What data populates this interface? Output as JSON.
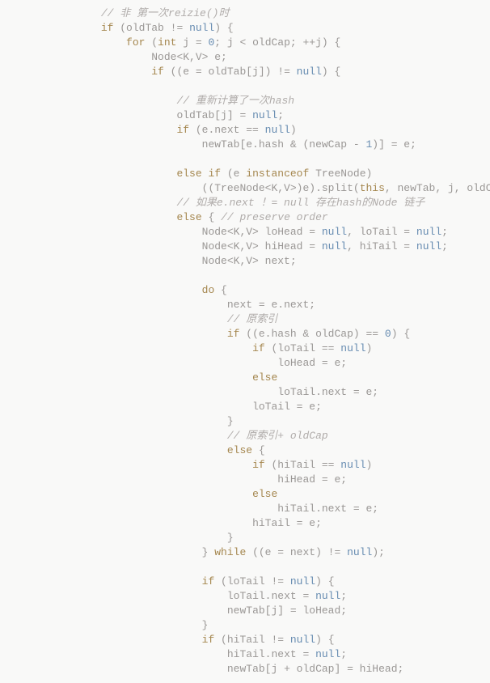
{
  "code": {
    "lines": [
      {
        "indent": 2,
        "tokens": [
          {
            "t": "cm",
            "v": "// 非 第一次reizie()时"
          }
        ]
      },
      {
        "indent": 2,
        "tokens": [
          {
            "t": "kw",
            "v": "if"
          },
          {
            "t": "pn",
            "v": " (oldTab != "
          },
          {
            "t": "kwn",
            "v": "null"
          },
          {
            "t": "pn",
            "v": ") {"
          }
        ]
      },
      {
        "indent": 3,
        "tokens": [
          {
            "t": "kw",
            "v": "for"
          },
          {
            "t": "pn",
            "v": " ("
          },
          {
            "t": "kw",
            "v": "int"
          },
          {
            "t": "pn",
            "v": " j = "
          },
          {
            "t": "num",
            "v": "0"
          },
          {
            "t": "pn",
            "v": "; j < oldCap; ++j) {"
          }
        ]
      },
      {
        "indent": 4,
        "tokens": [
          {
            "t": "id",
            "v": "Node<K,V> e;"
          }
        ]
      },
      {
        "indent": 4,
        "tokens": [
          {
            "t": "kw",
            "v": "if"
          },
          {
            "t": "pn",
            "v": " ((e = oldTab[j]) != "
          },
          {
            "t": "kwn",
            "v": "null"
          },
          {
            "t": "pn",
            "v": ") {"
          }
        ]
      },
      {
        "indent": 0,
        "tokens": [
          {
            "t": "pn",
            "v": " "
          }
        ]
      },
      {
        "indent": 5,
        "tokens": [
          {
            "t": "cm",
            "v": "// 重新计算了一次hash"
          }
        ]
      },
      {
        "indent": 5,
        "tokens": [
          {
            "t": "id",
            "v": "oldTab[j] = "
          },
          {
            "t": "kwn",
            "v": "null"
          },
          {
            "t": "pn",
            "v": ";"
          }
        ]
      },
      {
        "indent": 5,
        "tokens": [
          {
            "t": "kw",
            "v": "if"
          },
          {
            "t": "pn",
            "v": " (e.next == "
          },
          {
            "t": "kwn",
            "v": "null"
          },
          {
            "t": "pn",
            "v": ")"
          }
        ]
      },
      {
        "indent": 6,
        "tokens": [
          {
            "t": "id",
            "v": "newTab[e.hash & (newCap - "
          },
          {
            "t": "num",
            "v": "1"
          },
          {
            "t": "id",
            "v": ")] = e;"
          }
        ]
      },
      {
        "indent": 0,
        "tokens": [
          {
            "t": "pn",
            "v": " "
          }
        ]
      },
      {
        "indent": 5,
        "tokens": [
          {
            "t": "kw",
            "v": "else if"
          },
          {
            "t": "pn",
            "v": " (e "
          },
          {
            "t": "kw",
            "v": "instanceof"
          },
          {
            "t": "pn",
            "v": " TreeNode)"
          }
        ]
      },
      {
        "indent": 6,
        "tokens": [
          {
            "t": "id",
            "v": "((TreeNode<K,V>)e).split("
          },
          {
            "t": "kw",
            "v": "this"
          },
          {
            "t": "id",
            "v": ", newTab, j, oldCap);"
          }
        ]
      },
      {
        "indent": 5,
        "tokens": [
          {
            "t": "cm",
            "v": "// 如果e.next ！= null 存在hash的Node 链子"
          }
        ]
      },
      {
        "indent": 5,
        "tokens": [
          {
            "t": "kw",
            "v": "else"
          },
          {
            "t": "pn",
            "v": " { "
          },
          {
            "t": "cm",
            "v": "// preserve order"
          }
        ]
      },
      {
        "indent": 6,
        "tokens": [
          {
            "t": "id",
            "v": "Node<K,V> loHead = "
          },
          {
            "t": "kwn",
            "v": "null"
          },
          {
            "t": "id",
            "v": ", loTail = "
          },
          {
            "t": "kwn",
            "v": "null"
          },
          {
            "t": "pn",
            "v": ";"
          }
        ]
      },
      {
        "indent": 6,
        "tokens": [
          {
            "t": "id",
            "v": "Node<K,V> hiHead = "
          },
          {
            "t": "kwn",
            "v": "null"
          },
          {
            "t": "id",
            "v": ", hiTail = "
          },
          {
            "t": "kwn",
            "v": "null"
          },
          {
            "t": "pn",
            "v": ";"
          }
        ]
      },
      {
        "indent": 6,
        "tokens": [
          {
            "t": "id",
            "v": "Node<K,V> next;"
          }
        ]
      },
      {
        "indent": 0,
        "tokens": [
          {
            "t": "pn",
            "v": " "
          }
        ]
      },
      {
        "indent": 6,
        "tokens": [
          {
            "t": "kw",
            "v": "do"
          },
          {
            "t": "pn",
            "v": " {"
          }
        ]
      },
      {
        "indent": 7,
        "tokens": [
          {
            "t": "id",
            "v": "next = e.next;"
          }
        ]
      },
      {
        "indent": 7,
        "tokens": [
          {
            "t": "cm",
            "v": "// 原索引"
          }
        ]
      },
      {
        "indent": 7,
        "tokens": [
          {
            "t": "kw",
            "v": "if"
          },
          {
            "t": "pn",
            "v": " ((e.hash & oldCap) == "
          },
          {
            "t": "num",
            "v": "0"
          },
          {
            "t": "pn",
            "v": ") {"
          }
        ]
      },
      {
        "indent": 8,
        "tokens": [
          {
            "t": "kw",
            "v": "if"
          },
          {
            "t": "pn",
            "v": " (loTail == "
          },
          {
            "t": "kwn",
            "v": "null"
          },
          {
            "t": "pn",
            "v": ")"
          }
        ]
      },
      {
        "indent": 9,
        "tokens": [
          {
            "t": "id",
            "v": "loHead = e;"
          }
        ]
      },
      {
        "indent": 8,
        "tokens": [
          {
            "t": "kw",
            "v": "else"
          }
        ]
      },
      {
        "indent": 9,
        "tokens": [
          {
            "t": "id",
            "v": "loTail.next = e;"
          }
        ]
      },
      {
        "indent": 8,
        "tokens": [
          {
            "t": "id",
            "v": "loTail = e;"
          }
        ]
      },
      {
        "indent": 7,
        "tokens": [
          {
            "t": "pn",
            "v": "}"
          }
        ]
      },
      {
        "indent": 7,
        "tokens": [
          {
            "t": "cm",
            "v": "// 原索引+ oldCap"
          }
        ]
      },
      {
        "indent": 7,
        "tokens": [
          {
            "t": "kw",
            "v": "else"
          },
          {
            "t": "pn",
            "v": " {"
          }
        ]
      },
      {
        "indent": 8,
        "tokens": [
          {
            "t": "kw",
            "v": "if"
          },
          {
            "t": "pn",
            "v": " (hiTail == "
          },
          {
            "t": "kwn",
            "v": "null"
          },
          {
            "t": "pn",
            "v": ")"
          }
        ]
      },
      {
        "indent": 9,
        "tokens": [
          {
            "t": "id",
            "v": "hiHead = e;"
          }
        ]
      },
      {
        "indent": 8,
        "tokens": [
          {
            "t": "kw",
            "v": "else"
          }
        ]
      },
      {
        "indent": 9,
        "tokens": [
          {
            "t": "id",
            "v": "hiTail.next = e;"
          }
        ]
      },
      {
        "indent": 8,
        "tokens": [
          {
            "t": "id",
            "v": "hiTail = e;"
          }
        ]
      },
      {
        "indent": 7,
        "tokens": [
          {
            "t": "pn",
            "v": "}"
          }
        ]
      },
      {
        "indent": 6,
        "tokens": [
          {
            "t": "pn",
            "v": "} "
          },
          {
            "t": "kw",
            "v": "while"
          },
          {
            "t": "pn",
            "v": " ((e = next) != "
          },
          {
            "t": "kwn",
            "v": "null"
          },
          {
            "t": "pn",
            "v": ");"
          }
        ]
      },
      {
        "indent": 0,
        "tokens": [
          {
            "t": "pn",
            "v": " "
          }
        ]
      },
      {
        "indent": 6,
        "tokens": [
          {
            "t": "kw",
            "v": "if"
          },
          {
            "t": "pn",
            "v": " (loTail != "
          },
          {
            "t": "kwn",
            "v": "null"
          },
          {
            "t": "pn",
            "v": ") {"
          }
        ]
      },
      {
        "indent": 7,
        "tokens": [
          {
            "t": "id",
            "v": "loTail.next = "
          },
          {
            "t": "kwn",
            "v": "null"
          },
          {
            "t": "pn",
            "v": ";"
          }
        ]
      },
      {
        "indent": 7,
        "tokens": [
          {
            "t": "id",
            "v": "newTab[j] = loHead;"
          }
        ]
      },
      {
        "indent": 6,
        "tokens": [
          {
            "t": "pn",
            "v": "}"
          }
        ]
      },
      {
        "indent": 6,
        "tokens": [
          {
            "t": "kw",
            "v": "if"
          },
          {
            "t": "pn",
            "v": " (hiTail != "
          },
          {
            "t": "kwn",
            "v": "null"
          },
          {
            "t": "pn",
            "v": ") {"
          }
        ]
      },
      {
        "indent": 7,
        "tokens": [
          {
            "t": "id",
            "v": "hiTail.next = "
          },
          {
            "t": "kwn",
            "v": "null"
          },
          {
            "t": "pn",
            "v": ";"
          }
        ]
      },
      {
        "indent": 7,
        "tokens": [
          {
            "t": "id",
            "v": "newTab[j + oldCap] = hiHead;"
          }
        ]
      }
    ],
    "indent_unit": "    ",
    "base_indent": "        "
  }
}
